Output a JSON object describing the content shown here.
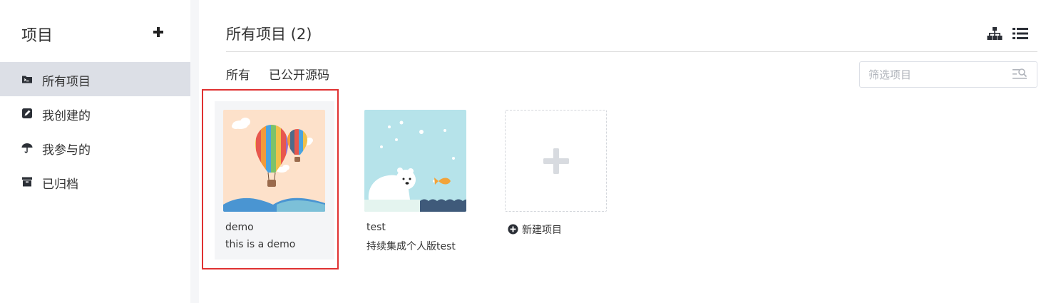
{
  "sidebar": {
    "title": "项目",
    "add_icon": "plus-icon",
    "items": [
      {
        "label": "所有项目",
        "icon": "folder-icon",
        "active": true
      },
      {
        "label": "我创建的",
        "icon": "edit-icon",
        "active": false
      },
      {
        "label": "我参与的",
        "icon": "umbrella-icon",
        "active": false
      },
      {
        "label": "已归档",
        "icon": "archive-icon",
        "active": false
      }
    ]
  },
  "main": {
    "title": "所有项目 (2)",
    "view_icons": [
      "sitemap-icon",
      "list-icon"
    ],
    "filters": [
      "所有",
      "已公开源码"
    ],
    "search": {
      "placeholder": "筛选项目",
      "value": "",
      "icon": "filter-search-icon"
    },
    "projects": [
      {
        "name": "demo",
        "description": "this is a demo",
        "thumbnail": "hot-air-balloon-icon",
        "selected": true
      },
      {
        "name": "test",
        "description": "持续集成个人版test",
        "thumbnail": "polar-bear-icon",
        "selected": false
      }
    ],
    "new_project": {
      "label": "新建项目",
      "icon": "plus-circle-icon"
    }
  },
  "colors": {
    "active_bg": "#dcdfe6",
    "highlight_border": "#e03131",
    "card_selected_bg": "#f4f5f7",
    "thumb_demo_bg": "#fde1ca",
    "thumb_test_bg": "#b6e3ea"
  }
}
